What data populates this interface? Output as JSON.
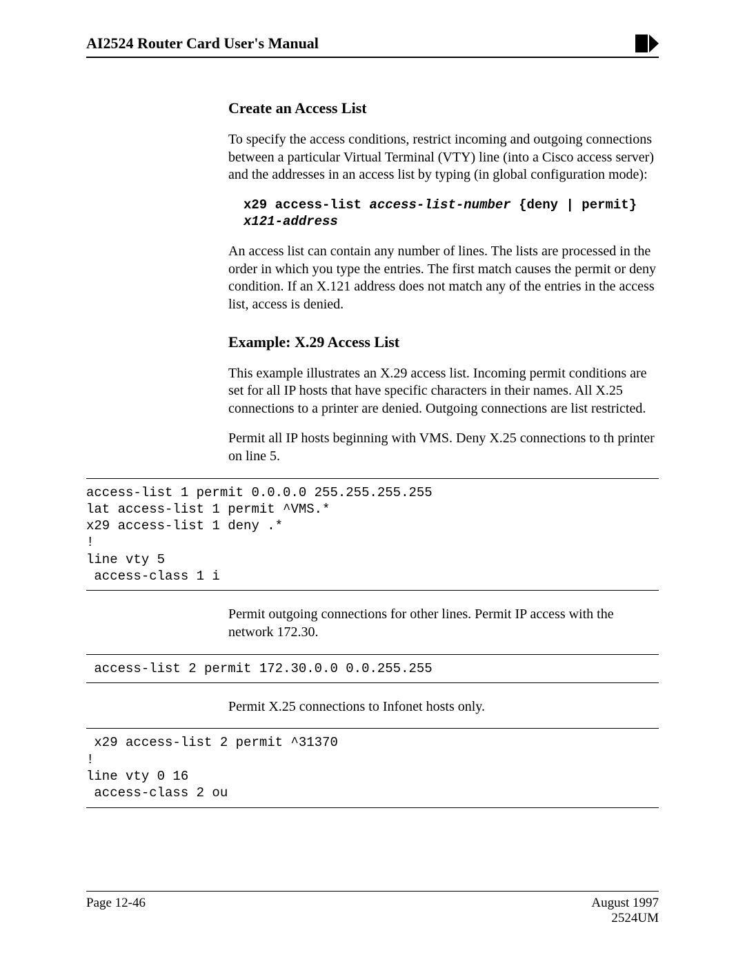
{
  "header": {
    "title": "AI2524 Router Card User's Manual"
  },
  "section1": {
    "heading": "Create an Access List",
    "para1": "To specify the access conditions, restrict incoming and outgoing connections between a particular Virtual Terminal (VTY) line (into a Cisco access server) and the addresses in an access list by typing (in global configuration mode):",
    "cmd_prefix": "x29 access-list ",
    "cmd_param1": "access-list-number",
    "cmd_mid": " {deny | permit} ",
    "cmd_param2": "x121-address",
    "para2": "An access list can contain any number of lines. The lists are processed in the order in which you type the entries. The first match causes the permit or deny condition. If an X.121 address does not match any of the entries in the access list, access is denied."
  },
  "section2": {
    "heading": "Example: X.29 Access List",
    "para1": "This example illustrates an X.29 access list. Incoming permit conditions are set for all IP hosts that have specific characters in their names. All X.25 connections to a printer are denied. Outgoing connections are list restricted.",
    "para2": "Permit all IP hosts beginning with VMS. Deny X.25 connections to th printer on line 5."
  },
  "code1": "access-list 1 permit 0.0.0.0 255.255.255.255\nlat access-list 1 permit ^VMS.*\nx29 access-list 1 deny .*\n!\nline vty 5\n access-class 1 i",
  "para_mid1": "Permit outgoing connections for other lines. Permit IP access with the network 172.30.",
  "code2": " access-list 2 permit 172.30.0.0 0.0.255.255",
  "para_mid2": "Permit X.25 connections to Infonet hosts only.",
  "code3": " x29 access-list 2 permit ^31370\n!\nline vty 0 16\n access-class 2 ou",
  "footer": {
    "left": "Page 12-46",
    "right1": "August 1997",
    "right2": "2524UM"
  }
}
